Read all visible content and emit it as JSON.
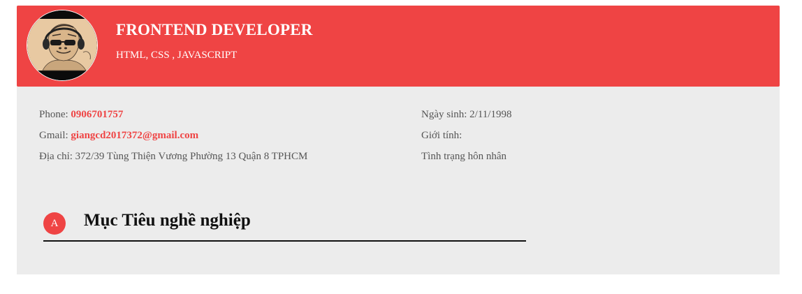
{
  "header": {
    "title": "FRONTEND DEVELOPER",
    "subtitle": "HTML, CSS , JAVASCRIPT",
    "avatar_icon": "gorilla-with-headphones",
    "accent_color": "#ef4444"
  },
  "contact": {
    "phone_label": "Phone:",
    "phone_value": "0906701757",
    "gmail_label": "Gmail:",
    "gmail_value": "giangcd2017372@gmail.com",
    "address_label": "Địa chỉ:",
    "address_value": "372/39 Tùng Thiện Vương Phường 13 Quận 8 TPHCM"
  },
  "personal": {
    "birth_label": "Ngày sinh:",
    "birth_value": "2/11/1998",
    "gender_label": "Giới tính:",
    "gender_value": "",
    "marital_label": "Tình trạng hôn nhân",
    "marital_value": ""
  },
  "section": {
    "badge": "A",
    "title": "Mục Tiêu nghề nghiệp"
  }
}
